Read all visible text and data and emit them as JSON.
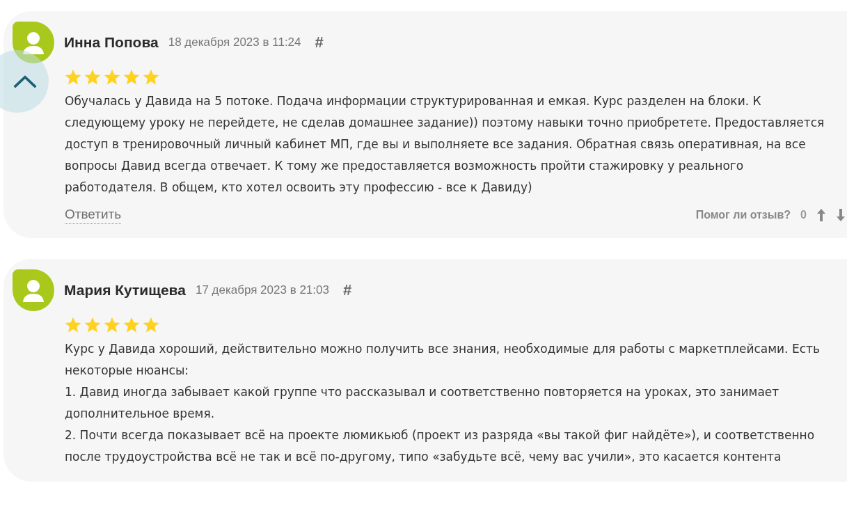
{
  "reviews": [
    {
      "author": "Инна Попова",
      "date": "18 декабря 2023 в 11:24",
      "anchor": "#",
      "stars": 5,
      "paragraphs": [
        "Обучалась у Давида на 5 потоке. Подача информации структурированная и емкая. Курс разделен на блоки. К следующему уроку не перейдете, не сделав домашнее задание)) поэтому навыки точно приобретете. Предоставляется доступ в тренировочный личный кабинет МП, где вы и выполняете все задания. Обратная связь оперативная, на все вопросы Давид всегда отвечает. К тому же предоставляется возможность пройти стажировку у реального работодателя. В общем, кто хотел освоить эту профессию - все к Давиду)"
      ],
      "reply": "Ответить",
      "helpful_label": "Помог ли отзыв?",
      "helpful_count": "0"
    },
    {
      "author": "Мария Кутищева",
      "date": "17 декабря 2023 в 21:03",
      "anchor": "#",
      "stars": 5,
      "paragraphs": [
        "Курс у Давида хороший, действительно можно получить все знания, необходимые для работы с маркетплейсами. Есть некоторые нюансы:",
        "1. Давид иногда забывает какой группе что рассказывал и соответственно повторяется на уроках, это занимает дополнительное время.",
        "2. Почти всегда показывает всё на проекте люмикьюб (проект из разряда «вы такой фиг найдёте»), и соответственно после трудоустройства всё не так и всё по-другому, типо «забудьте всё, чему вас учили», это касается контента"
      ]
    }
  ]
}
